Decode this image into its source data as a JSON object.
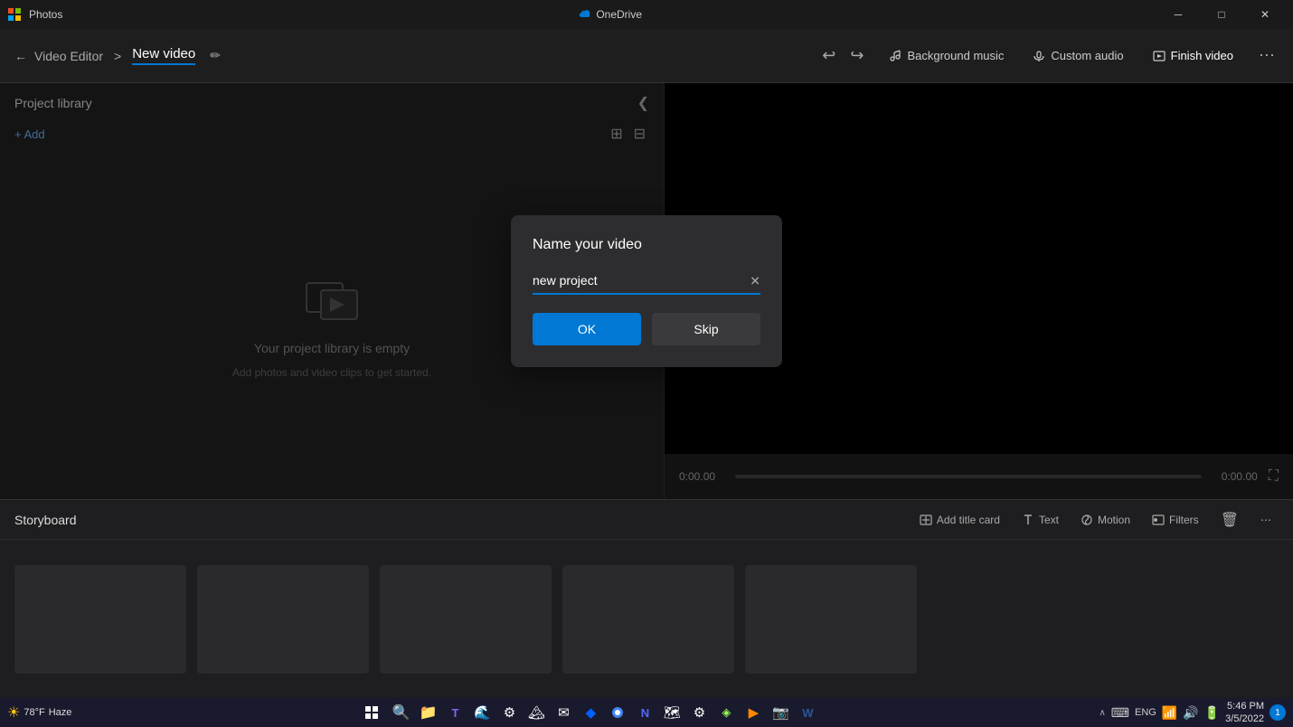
{
  "titlebar": {
    "app_name": "Photos",
    "onedrive_label": "OneDrive",
    "minimize_icon": "─",
    "restore_icon": "□",
    "close_icon": "✕"
  },
  "toolbar": {
    "back_icon": "←",
    "app_label": "Video Editor",
    "breadcrumb_sep": ">",
    "page_title": "New video",
    "edit_icon": "✏",
    "undo_icon": "↩",
    "redo_icon": "↪",
    "bg_music_label": "Background music",
    "custom_audio_label": "Custom audio",
    "finish_video_label": "Finish video",
    "more_icon": "⋯"
  },
  "left_panel": {
    "title": "Project library",
    "collapse_icon": "❮",
    "add_label": "+ Add",
    "view_grid1_icon": "⊞",
    "view_grid2_icon": "⊟",
    "empty_title": "Your project library is empty",
    "empty_subtitle": "Add photos and video clips to get started."
  },
  "video_controls": {
    "time_start": "0:00.00",
    "time_end": "0:00.00",
    "fullscreen_icon": "⛶"
  },
  "storyboard": {
    "title": "Storyboard",
    "add_title_card_label": "Add title card",
    "text_label": "Text",
    "motion_label": "Motion",
    "filters_label": "Filters",
    "delete_icon": "🗑",
    "more_icon": "⋯"
  },
  "dialog": {
    "title": "Name your video",
    "input_value": "new project",
    "clear_icon": "✕",
    "ok_label": "OK",
    "skip_label": "Skip"
  },
  "taskbar": {
    "weather_icon": "☀",
    "temp": "78°F",
    "weather_condition": "Haze",
    "time": "5:46 PM",
    "date": "3/5/2022",
    "lang": "ENG",
    "notification_count": "1",
    "apps": [
      {
        "name": "start",
        "icon": "⊞"
      },
      {
        "name": "search",
        "icon": "⌕"
      },
      {
        "name": "explorer",
        "icon": "📁"
      },
      {
        "name": "teams",
        "icon": "T"
      },
      {
        "name": "edge",
        "icon": "e"
      },
      {
        "name": "settings",
        "icon": "⚙"
      },
      {
        "name": "photos",
        "icon": "🖼"
      },
      {
        "name": "mail",
        "icon": "✉"
      },
      {
        "name": "dropbox",
        "icon": "◆"
      },
      {
        "name": "chrome",
        "icon": "⬤"
      },
      {
        "name": "app1",
        "icon": "N"
      },
      {
        "name": "photos2",
        "icon": "🏔"
      },
      {
        "name": "settings2",
        "icon": "⚙"
      },
      {
        "name": "task",
        "icon": "◈"
      },
      {
        "name": "vlc",
        "icon": "▶"
      },
      {
        "name": "capture",
        "icon": "◉"
      },
      {
        "name": "word",
        "icon": "W"
      }
    ]
  }
}
